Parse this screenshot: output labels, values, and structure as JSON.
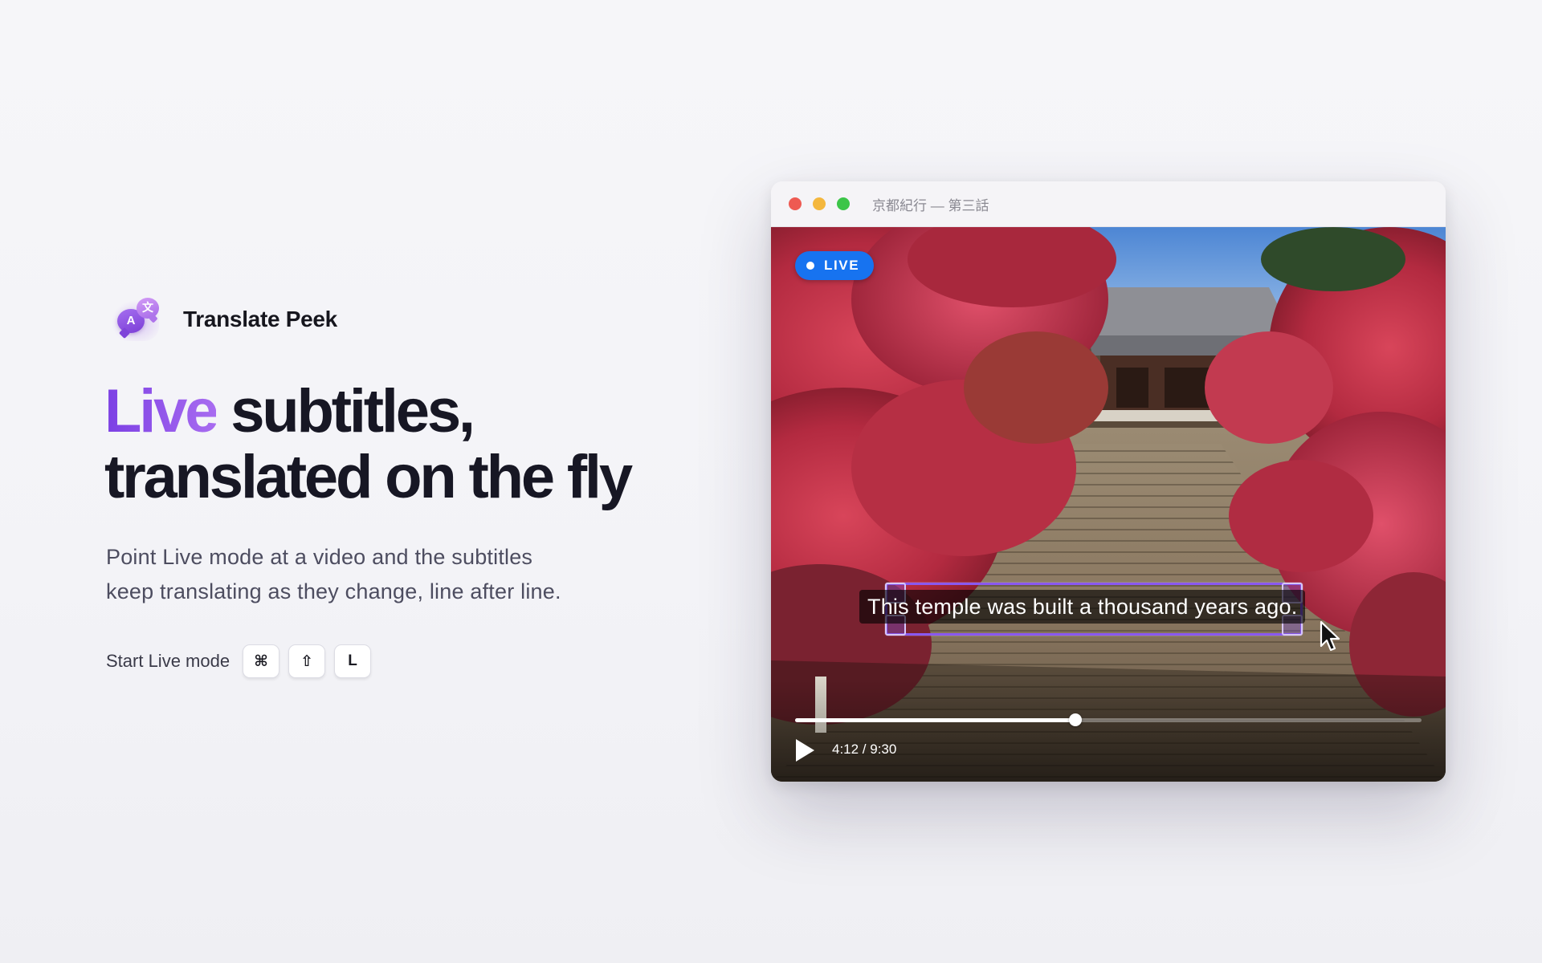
{
  "brand": {
    "name": "Translate Peek",
    "icon": "translate-bubbles-icon",
    "icon_letters": [
      "A",
      "文"
    ]
  },
  "hero": {
    "headline_accent": "Live",
    "headline_rest_line1": " subtitles,",
    "headline_line2": "translated on the fly",
    "subtext_line1": "Point Live mode at a video and the subtitles",
    "subtext_line2": "keep translating as they change, line after line.",
    "accent_color": "#8b4ee8"
  },
  "shortcut": {
    "label": "Start Live mode",
    "keys": [
      "⌘",
      "⇧",
      "L"
    ]
  },
  "window": {
    "title": "京都紀行 — 第三話",
    "traffic_lights": [
      "close",
      "minimize",
      "zoom"
    ]
  },
  "video": {
    "live_badge": "LIVE",
    "live_color": "#1773f0",
    "subtitle": "This temple was built a thousand years ago.",
    "selection_color": "#8a58f0",
    "progress": 0.448,
    "time": "4:12 / 9:30"
  }
}
